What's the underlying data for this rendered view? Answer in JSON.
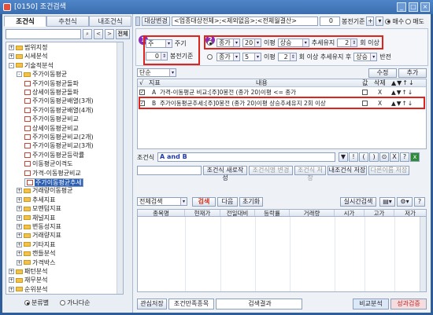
{
  "window": {
    "title": "[0150] 조건검색"
  },
  "left": {
    "tabs": [
      "조건식",
      "추천식",
      "내조건식"
    ],
    "search_nav_label": "전체",
    "tree": [
      {
        "level": 0,
        "type": "folder",
        "pm": "+",
        "label": "범위지정"
      },
      {
        "level": 0,
        "type": "folder",
        "pm": "+",
        "label": "시세분석"
      },
      {
        "level": 0,
        "type": "folder",
        "pm": "-",
        "label": "기술적분석"
      },
      {
        "level": 1,
        "type": "folder",
        "pm": "-",
        "label": "주가이동평균"
      },
      {
        "level": 2,
        "type": "doc",
        "label": "주가이동평균돌파"
      },
      {
        "level": 2,
        "type": "doc",
        "label": "상세이동평균돌파"
      },
      {
        "level": 2,
        "type": "doc",
        "label": "주가이동평균배열(3개)"
      },
      {
        "level": 2,
        "type": "doc",
        "label": "주가이동평균배열(4개)"
      },
      {
        "level": 2,
        "type": "doc",
        "label": "주가이동평균비교"
      },
      {
        "level": 2,
        "type": "doc",
        "label": "상세이동평균비교"
      },
      {
        "level": 2,
        "type": "doc",
        "label": "주가이동평균비교(2개)"
      },
      {
        "level": 2,
        "type": "doc",
        "label": "주가이동평균비교(3개)"
      },
      {
        "level": 2,
        "type": "doc",
        "label": "주가이동평균등락률"
      },
      {
        "level": 2,
        "type": "doc",
        "label": "이동평균이격도"
      },
      {
        "level": 2,
        "type": "doc",
        "label": "가격-이동평균비교"
      },
      {
        "level": 2,
        "type": "doc",
        "label": "주가이동평균추세",
        "selected": true
      },
      {
        "level": 1,
        "type": "folder",
        "pm": "+",
        "label": "거래량이동평균"
      },
      {
        "level": 1,
        "type": "folder",
        "pm": "+",
        "label": "추세지표"
      },
      {
        "level": 1,
        "type": "folder",
        "pm": "+",
        "label": "모멘텀지표"
      },
      {
        "level": 1,
        "type": "folder",
        "pm": "+",
        "label": "채널지표"
      },
      {
        "level": 1,
        "type": "folder",
        "pm": "+",
        "label": "변동성지표"
      },
      {
        "level": 1,
        "type": "folder",
        "pm": "+",
        "label": "거래량지표"
      },
      {
        "level": 1,
        "type": "folder",
        "pm": "+",
        "label": "기타지표"
      },
      {
        "level": 1,
        "type": "folder",
        "pm": "+",
        "label": "캔들분석"
      },
      {
        "level": 1,
        "type": "folder",
        "pm": "+",
        "label": "가격박스"
      },
      {
        "level": 0,
        "type": "folder",
        "pm": "+",
        "label": "패턴분석"
      },
      {
        "level": 0,
        "type": "folder",
        "pm": "+",
        "label": "재무분석"
      },
      {
        "level": 0,
        "type": "folder",
        "pm": "+",
        "label": "순위분석"
      }
    ],
    "radio": {
      "opt1": "분류별",
      "opt2": "가나다순"
    }
  },
  "top": {
    "target_btn": "대상변경",
    "target_text": "<업종대상전체>;<제외없음>;<전체월결산>",
    "spin_val": "0",
    "ref_label": "봉전기준",
    "buy_label": "매수",
    "sell_label": "매도"
  },
  "params": {
    "badge1": "1",
    "badge2": "2",
    "period_sel": "주",
    "period_label": "주기",
    "offset_val": "0",
    "offset_label": "봉전기준",
    "row1": {
      "price": "종가",
      "n": "20",
      "ma_label": "이평",
      "dir": "상승",
      "trend_label": "추세유지",
      "cnt": "2",
      "tail": "회 이상"
    },
    "row2": {
      "price": "종가",
      "n": "5",
      "ma_label": "이평",
      "cnt": "2",
      "mid": "회 이상 추세유지 후",
      "dir": "상승",
      "tail": "반전"
    }
  },
  "cond": {
    "kind": "단순",
    "modify_btn": "수정",
    "add_btn": "추가",
    "headers": {
      "idx": "지표",
      "content": "내용",
      "val": "값",
      "del": "삭제"
    },
    "rows": [
      {
        "checked": true,
        "key": "A",
        "text": "가격-이동평균 비교:[주]0봉전 (종가 20)이평 <= 종가"
      },
      {
        "checked": true,
        "key": "B",
        "text": "주가이동평균추세:[주]0봉전 (종가 20)이평 상승추세유지 2회 이상"
      }
    ],
    "del_mark": "X",
    "expr_label": "조건식",
    "expr": "A and B",
    "ops": [
      "▼",
      "!",
      "(",
      ")",
      "⊙",
      "X",
      "?"
    ],
    "btns": [
      "조건식 새로작성",
      "조건식명 변경",
      "조건식 저장",
      "내조건식 저장",
      "다른이름 저장"
    ]
  },
  "results": {
    "scope": "전체검색",
    "search_btn": "검색",
    "next_btn": "다음",
    "reset_btn": "초기화",
    "realtime_btn": "실시간검색",
    "columns": [
      "종목명",
      "현재가",
      "전일대비",
      "등락률",
      "거래량",
      "시가",
      "고가",
      "저가"
    ]
  },
  "footer": {
    "tab1": "관심저장",
    "tab2": "조건만족종목",
    "result_label": "검색결과",
    "compare_btn": "비교분석",
    "verify_btn": "성과검증"
  },
  "colors": {
    "highlight": "#e0241b",
    "badge": "#8c2bb6",
    "select": "#2a5fb3"
  }
}
